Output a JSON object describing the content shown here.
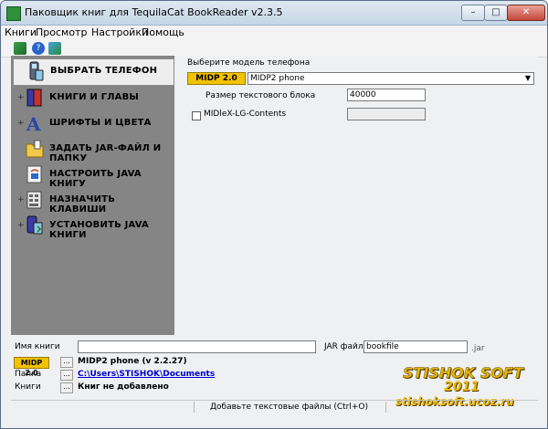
{
  "window": {
    "title": "Паковщик книг для TequilaCat BookReader v2.3.5",
    "minimize_glyph": "–",
    "maximize_glyph": "□",
    "close_glyph": "✕"
  },
  "menu": [
    "Книги",
    "Просмотр",
    "Настройки",
    "Помощь"
  ],
  "toolbar": {
    "icons": [
      "save-icon",
      "help-icon",
      "exit-icon"
    ]
  },
  "sidebar": {
    "items": [
      {
        "label": "ВЫБРАТЬ ТЕЛЕФОН",
        "icon": "phone-icon",
        "selected": true,
        "expander": ""
      },
      {
        "label": "КНИГИ И ГЛАВЫ",
        "icon": "books-icon",
        "selected": false,
        "expander": "+"
      },
      {
        "label": "ШРИФТЫ И ЦВЕТА",
        "icon": "font-icon",
        "selected": false,
        "expander": "+"
      },
      {
        "label": "ЗАДАТЬ JAR-ФАЙЛ И ПАПКУ",
        "icon": "folder-icon",
        "selected": false,
        "expander": ""
      },
      {
        "label": "НАСТРОИТЬ JAVA КНИГУ",
        "icon": "java-config-icon",
        "selected": false,
        "expander": ""
      },
      {
        "label": "НАЗНАЧИТЬ КЛАВИШИ",
        "icon": "keys-icon",
        "selected": false,
        "expander": "+"
      },
      {
        "label": "УСТАНОВИТЬ JAVA КНИГИ",
        "icon": "install-icon",
        "selected": false,
        "expander": "+"
      }
    ]
  },
  "phone_panel": {
    "section_label": "Выберите модель телефона",
    "midp_badge": "MIDP 2.0",
    "model_value": "MIDP2 phone",
    "dropdown_glyph": "▼",
    "text_block_label": "Размер текстового блока",
    "text_block_value": "40000",
    "midlet_label": "MIDleX-LG-Contents",
    "midlet_checked": false,
    "midlet_value": ""
  },
  "bottom": {
    "book_name_label": "Имя книги",
    "book_name_value": "",
    "jar_label": "JAR файл:",
    "jar_value": "bookfile",
    "jar_ext": ".jar",
    "midp_badge": "MIDP 2.0",
    "phone_info": "MIDP2 phone (v 2.2.27)",
    "folder_label": "Папка",
    "folder_path": "C:\\Users\\STISHOK\\Documents",
    "books_label": "Книги",
    "books_status": "Книг не добавлено",
    "dots": "..."
  },
  "status": {
    "text": "Добавьте текстовые файлы (Ctrl+O)"
  },
  "watermark": {
    "line1": "STISHOK SOFT",
    "line2": "2011",
    "line3": "stishoksoft.ucoz.ru"
  }
}
